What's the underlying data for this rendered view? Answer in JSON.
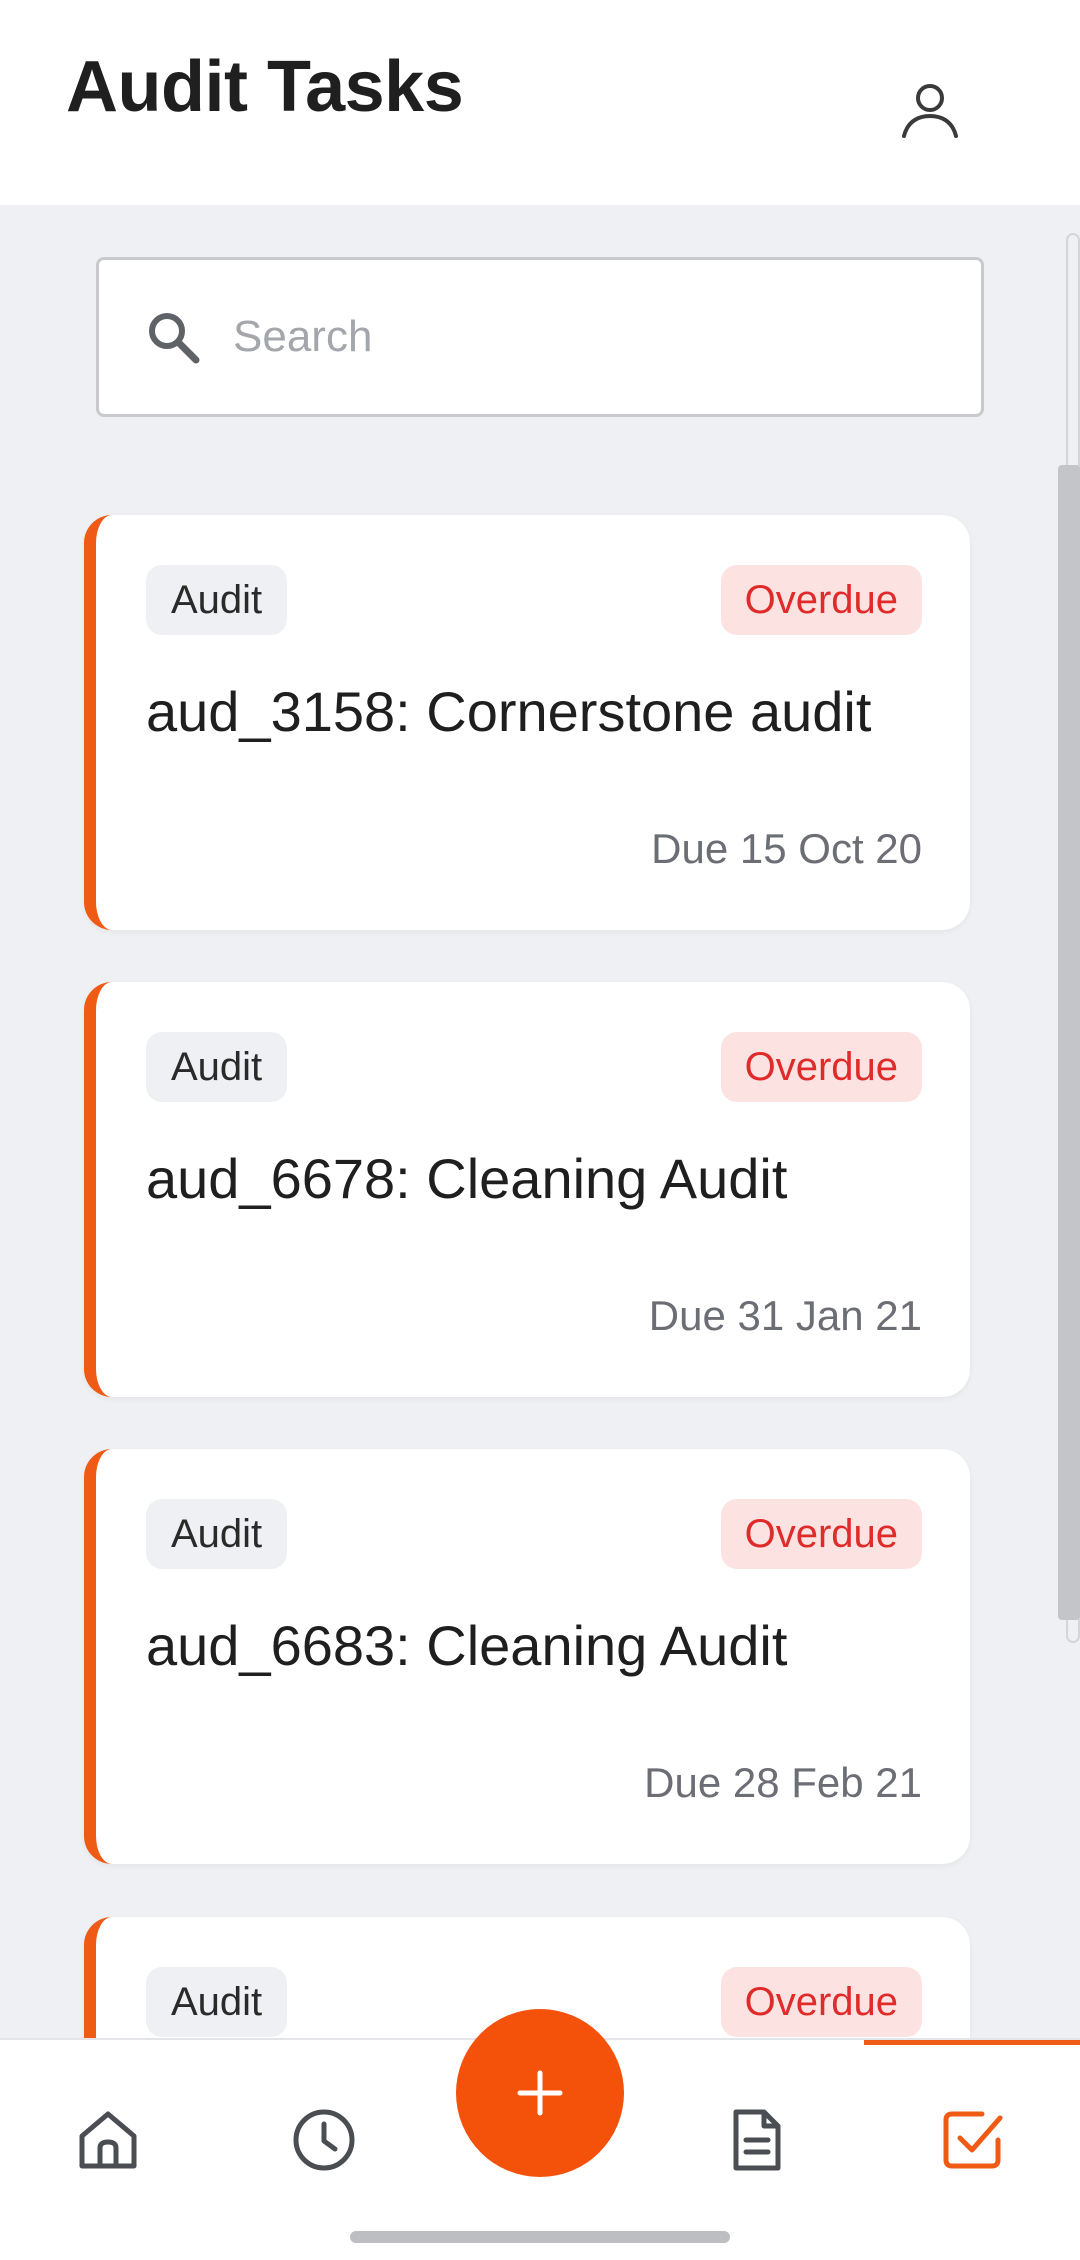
{
  "header": {
    "title": "Audit Tasks",
    "profile_icon": "user-icon"
  },
  "search": {
    "placeholder": "Search",
    "value": "",
    "icon": "search-icon"
  },
  "tasks": [
    {
      "type": "Audit",
      "status": "Overdue",
      "title": "aud_3158: Cornerstone audit",
      "due": "Due 15 Oct 20"
    },
    {
      "type": "Audit",
      "status": "Overdue",
      "title": "aud_6678: Cleaning Audit",
      "due": "Due 31 Jan 21"
    },
    {
      "type": "Audit",
      "status": "Overdue",
      "title": "aud_6683: Cleaning Audit",
      "due": "Due 28 Feb 21"
    },
    {
      "type": "Audit",
      "status": "Overdue",
      "title": "",
      "due": ""
    }
  ],
  "fab": {
    "label": "+",
    "icon": "plus-icon"
  },
  "bottom_nav": {
    "items": [
      {
        "icon": "home-icon",
        "active": false
      },
      {
        "icon": "clock-icon",
        "active": false
      },
      {
        "icon": "document-icon",
        "active": false
      },
      {
        "icon": "checkbox-icon",
        "active": true
      }
    ]
  },
  "colors": {
    "accent": "#ef5a14",
    "overdue_text": "#e02b2b",
    "overdue_bg": "#fde2e2",
    "background": "#eef0f3"
  }
}
